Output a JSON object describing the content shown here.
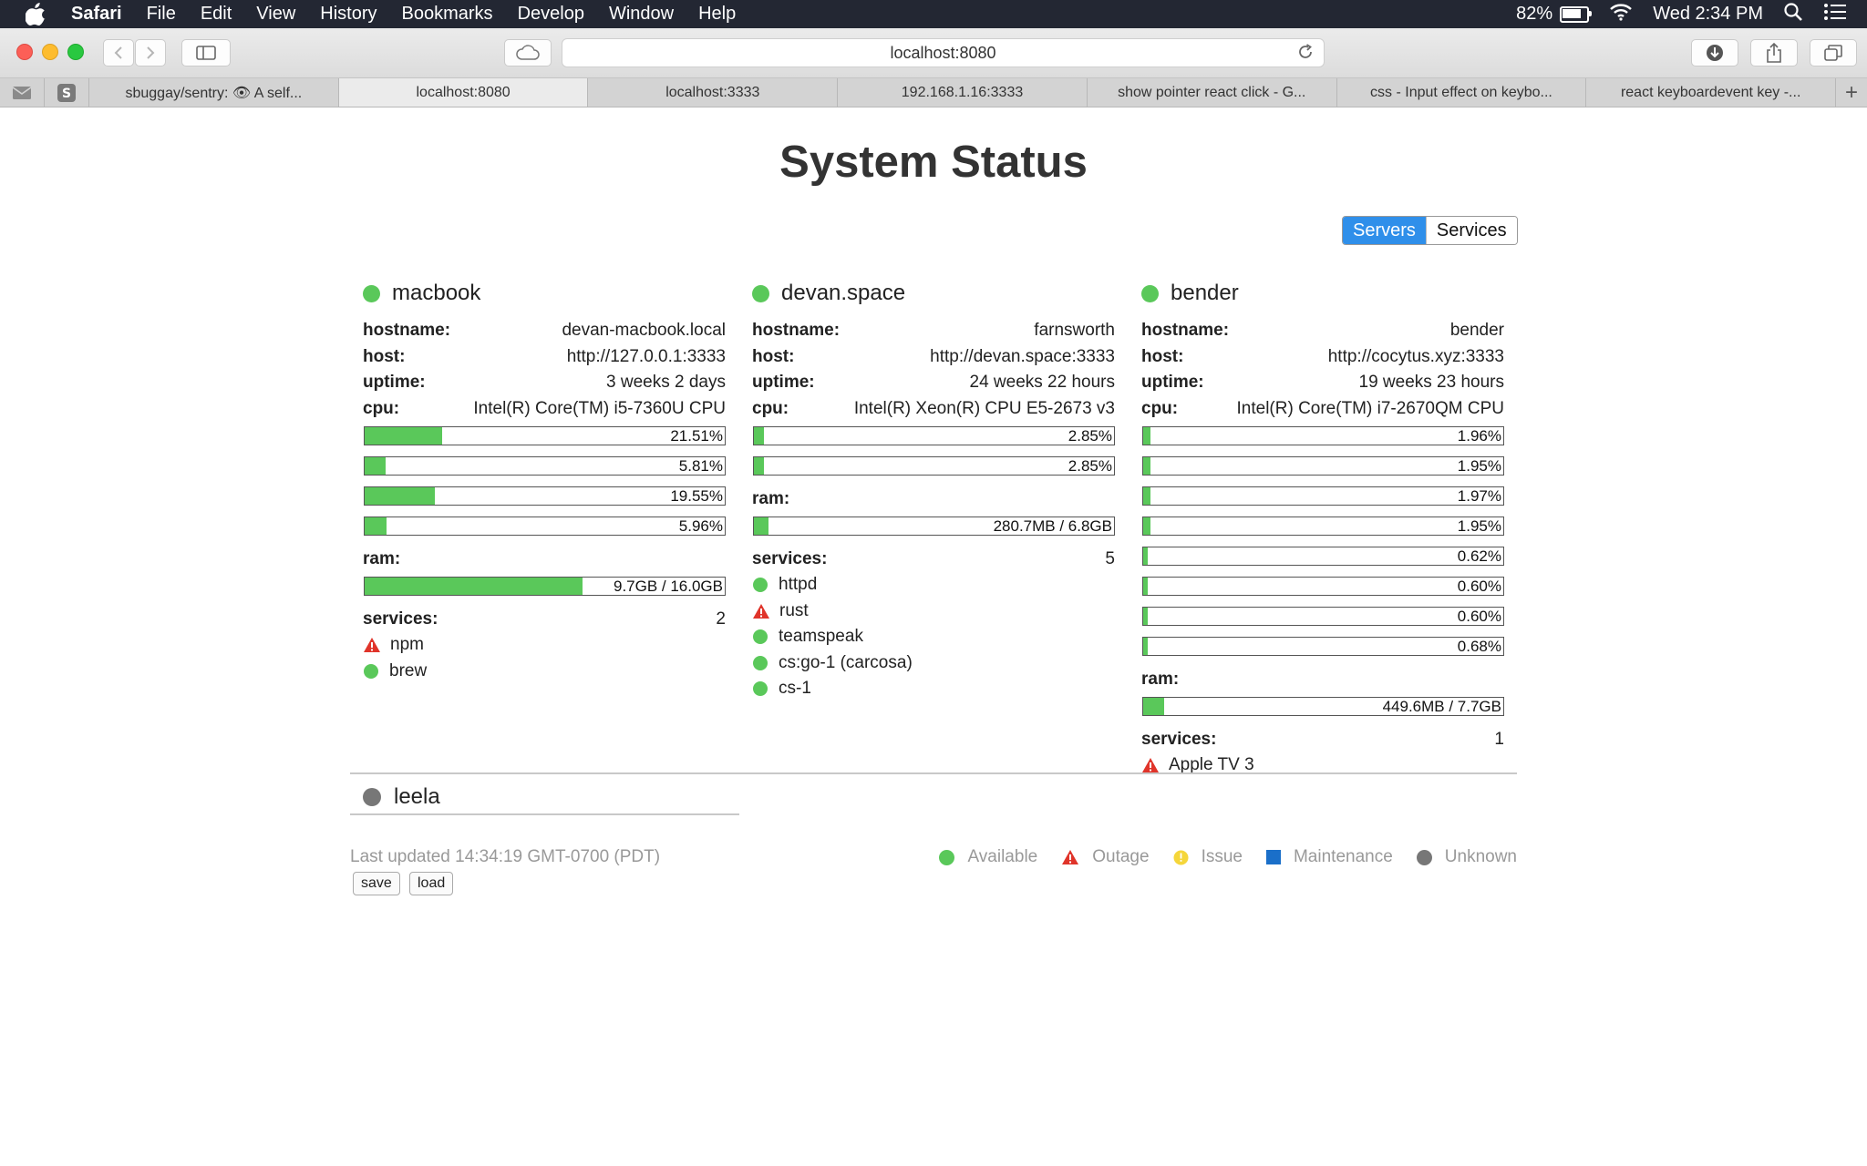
{
  "menubar": {
    "app": "Safari",
    "items": [
      "File",
      "Edit",
      "View",
      "History",
      "Bookmarks",
      "Develop",
      "Window",
      "Help"
    ],
    "battery": "82%",
    "battery_level": 0.82,
    "clock": "Wed 2:34 PM"
  },
  "browser": {
    "url": "localhost:8080",
    "tabs": [
      {
        "label": "sbuggay/sentry: 👁 A self...",
        "active": false
      },
      {
        "label": "localhost:8080",
        "active": true
      },
      {
        "label": "localhost:3333",
        "active": false
      },
      {
        "label": "192.168.1.16:3333",
        "active": false
      },
      {
        "label": "show pointer react click - G...",
        "active": false
      },
      {
        "label": "css - Input effect on keybo...",
        "active": false
      },
      {
        "label": "react keyboardevent key -...",
        "active": false
      }
    ],
    "new_tab": "+"
  },
  "page": {
    "title": "System Status",
    "toggle": {
      "servers": "Servers",
      "services": "Services"
    },
    "labels": {
      "hostname": "hostname:",
      "host": "host:",
      "uptime": "uptime:",
      "cpu": "cpu:",
      "ram": "ram:",
      "services": "services:"
    },
    "servers": [
      {
        "name": "macbook",
        "status": "available",
        "hostname": "devan-macbook.local",
        "host": "http://127.0.0.1:3333",
        "uptime": "3 weeks 2 days",
        "cpu": "Intel(R) Core(TM) i5-7360U CPU",
        "cores": [
          {
            "label": "21.51%",
            "pct": 21.51
          },
          {
            "label": "5.81%",
            "pct": 5.81
          },
          {
            "label": "19.55%",
            "pct": 19.55
          },
          {
            "label": "5.96%",
            "pct": 5.96
          }
        ],
        "ram": {
          "label": "9.7GB / 16.0GB",
          "pct": 60.6
        },
        "services_count": "2",
        "services": [
          {
            "name": "npm",
            "status": "outage"
          },
          {
            "name": "brew",
            "status": "available"
          }
        ]
      },
      {
        "name": "devan.space",
        "status": "available",
        "hostname": "farnsworth",
        "host": "http://devan.space:3333",
        "uptime": "24 weeks 22 hours",
        "cpu": "Intel(R) Xeon(R) CPU E5-2673 v3",
        "cores": [
          {
            "label": "2.85%",
            "pct": 2.85
          },
          {
            "label": "2.85%",
            "pct": 2.85
          }
        ],
        "ram": {
          "label": "280.7MB / 6.8GB",
          "pct": 4.0
        },
        "services_count": "5",
        "services": [
          {
            "name": "httpd",
            "status": "available"
          },
          {
            "name": "rust",
            "status": "outage"
          },
          {
            "name": "teamspeak",
            "status": "available"
          },
          {
            "name": "cs:go-1 (carcosa)",
            "status": "available"
          },
          {
            "name": "cs-1",
            "status": "available"
          }
        ]
      },
      {
        "name": "bender",
        "status": "available",
        "hostname": "bender",
        "host": "http://cocytus.xyz:3333",
        "uptime": "19 weeks 23 hours",
        "cpu": "Intel(R) Core(TM) i7-2670QM CPU",
        "cores": [
          {
            "label": "1.96%",
            "pct": 1.96
          },
          {
            "label": "1.95%",
            "pct": 1.95
          },
          {
            "label": "1.97%",
            "pct": 1.97
          },
          {
            "label": "1.95%",
            "pct": 1.95
          },
          {
            "label": "0.62%",
            "pct": 0.62
          },
          {
            "label": "0.60%",
            "pct": 0.6
          },
          {
            "label": "0.60%",
            "pct": 0.6
          },
          {
            "label": "0.68%",
            "pct": 0.68
          }
        ],
        "ram": {
          "label": "449.6MB / 7.7GB",
          "pct": 5.7
        },
        "services_count": "1",
        "services": [
          {
            "name": "Apple TV 3",
            "status": "outage"
          }
        ]
      }
    ],
    "offline_server": {
      "name": "leela",
      "status": "unknown"
    },
    "last_updated": "Last updated 14:34:19 GMT-0700 (PDT)",
    "buttons": {
      "save": "save",
      "load": "load"
    },
    "legend": {
      "available": "Available",
      "outage": "Outage",
      "issue": "Issue",
      "maintenance": "Maintenance",
      "unknown": "Unknown"
    },
    "colors": {
      "available": "#5ac85a",
      "outage": "#e0342a",
      "issue": "#f5d63a",
      "maintenance": "#1a6fc9",
      "unknown": "#777777",
      "accent": "#2f8fea"
    }
  }
}
